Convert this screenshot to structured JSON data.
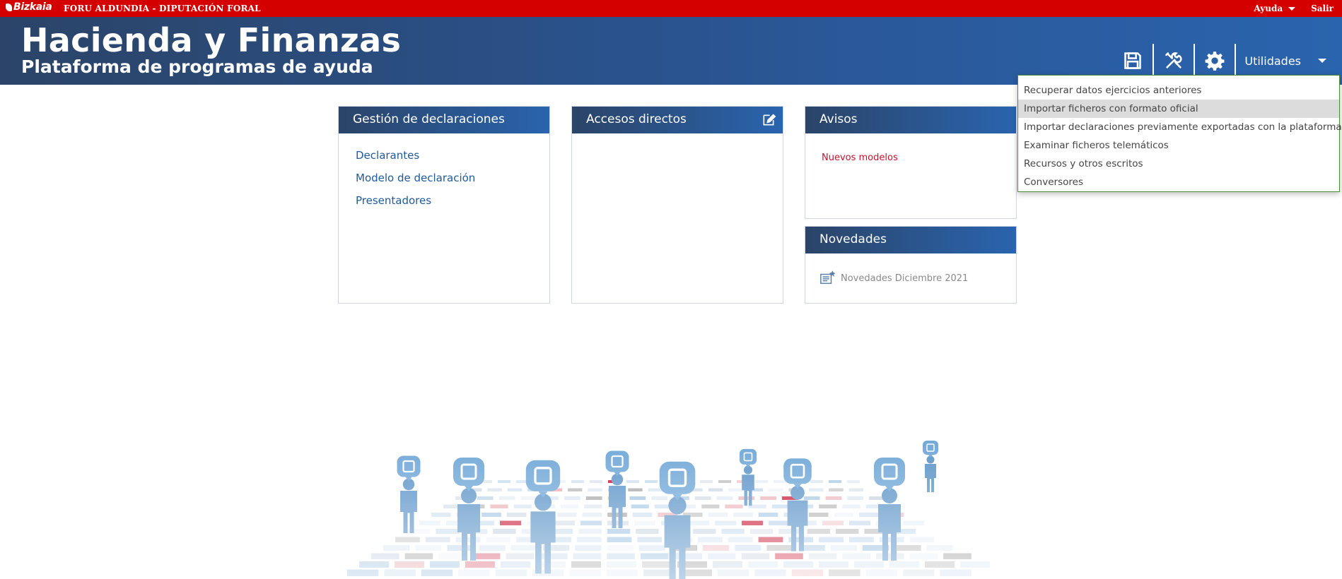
{
  "topbar": {
    "logo_text": "Bizkaia",
    "org_name": "FORU ALDUNDIA - DIPUTACIÓN FORAL",
    "help_label": "Ayuda",
    "exit_label": "Salir"
  },
  "header": {
    "title": "Hacienda y Finanzas",
    "subtitle": "Plataforma de programas de ayuda",
    "tools": [
      {
        "icon": "save-icon"
      },
      {
        "icon": "tools-icon"
      },
      {
        "icon": "gear-icon"
      }
    ],
    "utilities_label": "Utilidades"
  },
  "utilities_menu": {
    "items": [
      {
        "label": "Recuperar datos ejercicios anteriores"
      },
      {
        "label": "Importar ficheros con formato oficial",
        "highlighted": true
      },
      {
        "label": "Importar declaraciones previamente exportadas con la plataforma"
      },
      {
        "label": "Examinar ficheros telemáticos"
      },
      {
        "label": "Recursos y otros escritos"
      },
      {
        "label": "Conversores"
      }
    ]
  },
  "panels": {
    "gestion": {
      "title": "Gestión de declaraciones",
      "links": [
        {
          "label": "Declarantes"
        },
        {
          "label": "Modelo de declaración"
        },
        {
          "label": "Presentadores"
        }
      ]
    },
    "accesos": {
      "title": "Accesos directos",
      "icon": "edit-icon"
    },
    "avisos": {
      "title": "Avisos",
      "link": "Nuevos modelos"
    },
    "novedades": {
      "title": "Novedades",
      "item": "Novedades Diciembre 2021",
      "icon": "news-document-icon"
    }
  },
  "colors": {
    "topbar_red": "#d40000",
    "header_blue": "#2a5593",
    "link_blue": "#1f5a9e",
    "alert_red": "#c8102e",
    "menu_border_green": "#4f8a3a"
  }
}
